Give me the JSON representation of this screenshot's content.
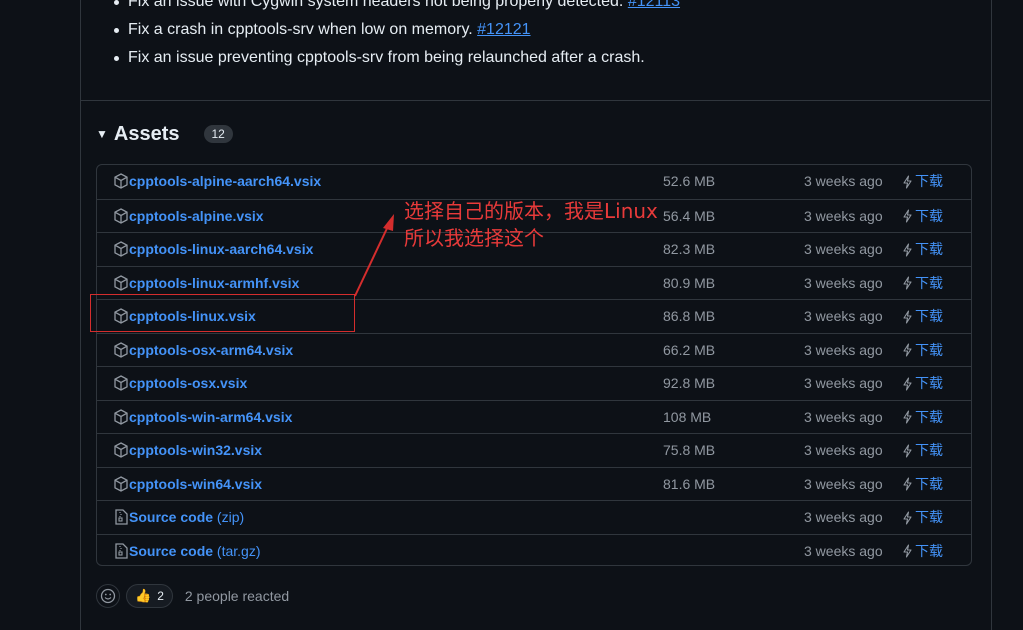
{
  "release_notes": {
    "items": [
      {
        "text": "Fix an issue with Cygwin system headers not being properly detected. ",
        "link": "#12113"
      },
      {
        "text": "Fix a crash in cpptools-srv when low on memory. ",
        "link": "#12121"
      },
      {
        "text": "Fix an issue preventing cpptools-srv from being relaunched after a crash.",
        "link": ""
      }
    ]
  },
  "assets": {
    "title": "Assets",
    "count": "12",
    "download_label": "下载",
    "files": [
      {
        "name": "cpptools-alpine-aarch64.vsix",
        "size": "52.6 MB",
        "date": "3 weeks ago",
        "icon": "package-icon"
      },
      {
        "name": "cpptools-alpine.vsix",
        "size": "56.4 MB",
        "date": "3 weeks ago",
        "icon": "package-icon"
      },
      {
        "name": "cpptools-linux-aarch64.vsix",
        "size": "82.3 MB",
        "date": "3 weeks ago",
        "icon": "package-icon"
      },
      {
        "name": "cpptools-linux-armhf.vsix",
        "size": "80.9 MB",
        "date": "3 weeks ago",
        "icon": "package-icon"
      },
      {
        "name": "cpptools-linux.vsix",
        "size": "86.8 MB",
        "date": "3 weeks ago",
        "icon": "package-icon"
      },
      {
        "name": "cpptools-osx-arm64.vsix",
        "size": "66.2 MB",
        "date": "3 weeks ago",
        "icon": "package-icon"
      },
      {
        "name": "cpptools-osx.vsix",
        "size": "92.8 MB",
        "date": "3 weeks ago",
        "icon": "package-icon"
      },
      {
        "name": "cpptools-win-arm64.vsix",
        "size": "108 MB",
        "date": "3 weeks ago",
        "icon": "package-icon"
      },
      {
        "name": "cpptools-win32.vsix",
        "size": "75.8 MB",
        "date": "3 weeks ago",
        "icon": "package-icon"
      },
      {
        "name": "cpptools-win64.vsix",
        "size": "81.6 MB",
        "date": "3 weeks ago",
        "icon": "package-icon"
      }
    ],
    "source": [
      {
        "name": "Source code",
        "ext": "(zip)",
        "date": "3 weeks ago",
        "icon": "file-zip-icon"
      },
      {
        "name": "Source code",
        "ext": "(tar.gz)",
        "date": "3 weeks ago",
        "icon": "file-zip-icon"
      }
    ]
  },
  "reactions": {
    "thumbs_count": "2",
    "text": "2 people reacted"
  },
  "annotation": {
    "line1": "选择自己的版本，我是Linux",
    "line2": "所以我选择这个",
    "color": "#e83a3a"
  },
  "colors": {
    "background": "#0d1117",
    "link": "#4493f8",
    "muted": "#9198a1",
    "border": "#30363d",
    "annotation": "#d42d2d"
  }
}
